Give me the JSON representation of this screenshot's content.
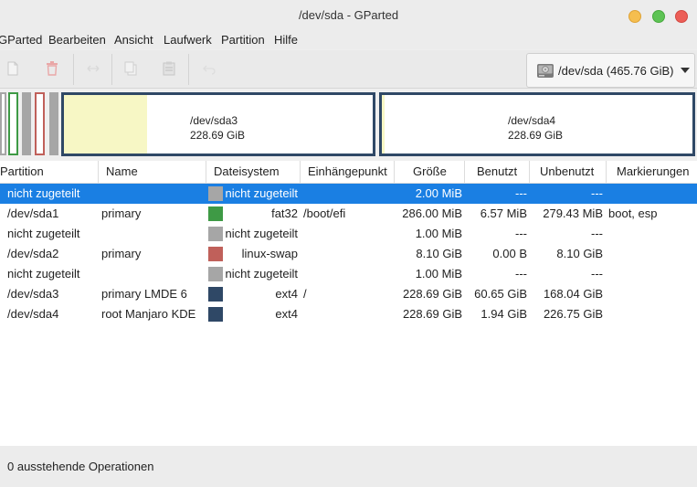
{
  "window": {
    "title": "/dev/sda - GParted"
  },
  "menubar": {
    "items": [
      "GParted",
      "Bearbeiten",
      "Ansicht",
      "Laufwerk",
      "Partition",
      "Hilfe"
    ]
  },
  "toolbar": {
    "icons": [
      "new-partition-icon",
      "delete-icon",
      "resize-move-icon",
      "copy-icon",
      "paste-icon",
      "undo-icon",
      "apply-icon"
    ],
    "device_label": "/dev/sda (465.76 GiB)"
  },
  "diskmap": {
    "sda3": {
      "name": "/dev/sda3",
      "size": "228.69 GiB"
    },
    "sda4": {
      "name": "/dev/sda4",
      "size": "228.69 GiB"
    }
  },
  "table": {
    "headers": [
      "Partition",
      "Name",
      "Dateisystem",
      "Einhängepunkt",
      "Größe",
      "Benutzt",
      "Unbenutzt",
      "Markierungen"
    ],
    "rows": [
      {
        "partition": "nicht zugeteilt",
        "name": "",
        "fs": "nicht zugeteilt",
        "fs_color": "#a6a6a6",
        "mount": "",
        "size": "2.00 MiB",
        "used": "---",
        "unused": "---",
        "flags": "",
        "selected": true
      },
      {
        "partition": "/dev/sda1",
        "name": "primary",
        "fs": "fat32",
        "fs_color": "#3e9a45",
        "mount": "/boot/efi",
        "size": "286.00 MiB",
        "used": "6.57 MiB",
        "unused": "279.43 MiB",
        "flags": "boot, esp"
      },
      {
        "partition": "nicht zugeteilt",
        "name": "",
        "fs": "nicht zugeteilt",
        "fs_color": "#a6a6a6",
        "mount": "",
        "size": "1.00 MiB",
        "used": "---",
        "unused": "---",
        "flags": ""
      },
      {
        "partition": "/dev/sda2",
        "name": "primary",
        "fs": "linux-swap",
        "fs_color": "#c0605a",
        "mount": "",
        "size": "8.10 GiB",
        "used": "0.00 B",
        "unused": "8.10 GiB",
        "flags": ""
      },
      {
        "partition": "nicht zugeteilt",
        "name": "",
        "fs": "nicht zugeteilt",
        "fs_color": "#a6a6a6",
        "mount": "",
        "size": "1.00 MiB",
        "used": "---",
        "unused": "---",
        "flags": ""
      },
      {
        "partition": "/dev/sda3",
        "name": "primary LMDE 6",
        "fs": "ext4",
        "fs_color": "#2f4866",
        "mount": "/",
        "size": "228.69 GiB",
        "used": "60.65 GiB",
        "unused": "168.04 GiB",
        "flags": ""
      },
      {
        "partition": "/dev/sda4",
        "name": "root Manjaro KDE",
        "fs": "ext4",
        "fs_color": "#2f4866",
        "mount": "",
        "size": "228.69 GiB",
        "used": "1.94 GiB",
        "unused": "226.75 GiB",
        "flags": ""
      }
    ]
  },
  "colors": {
    "selection": "#1a7fe3",
    "ext4": "#2f4866",
    "fat32": "#3e9a45",
    "linux_swap": "#c0605a",
    "unallocated": "#a6a6a6",
    "used_space": "#f7f7c5"
  },
  "status": {
    "text": "0 ausstehende Operationen"
  }
}
